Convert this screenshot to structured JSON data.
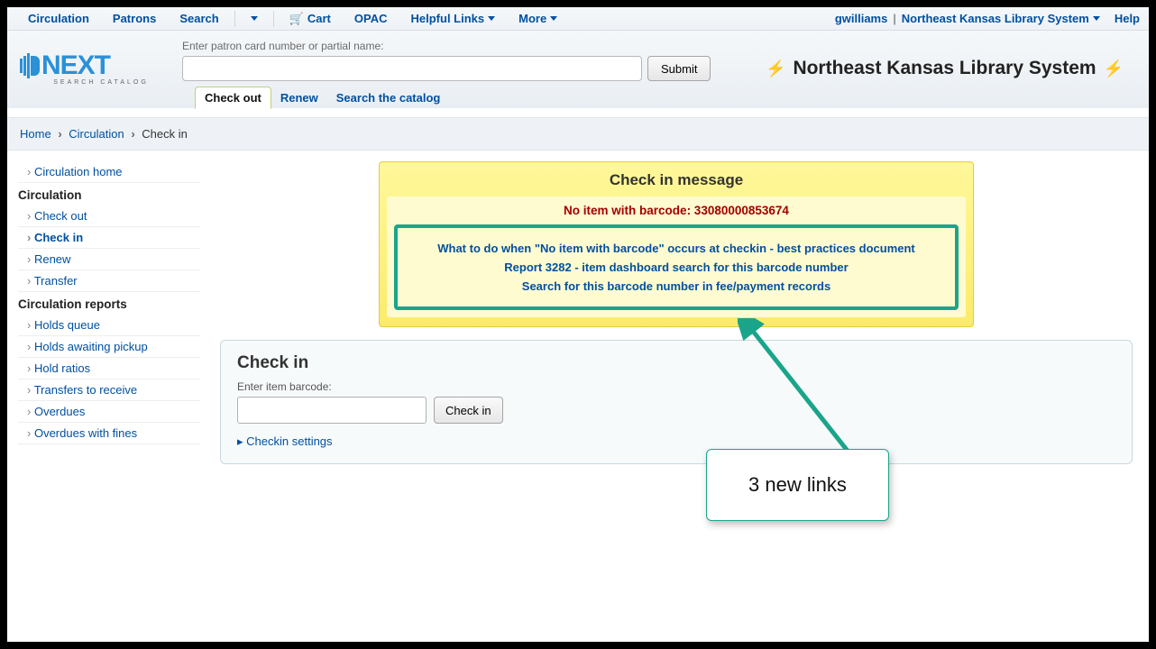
{
  "topnav": {
    "circulation": "Circulation",
    "patrons": "Patrons",
    "search": "Search",
    "cart": "Cart",
    "opac": "OPAC",
    "helpful": "Helpful Links",
    "more": "More",
    "user": "gwilliams",
    "system": "Northeast Kansas Library System",
    "help": "Help"
  },
  "logo": {
    "main": "NEXT",
    "sub": "SEARCH CATALOG"
  },
  "search": {
    "label": "Enter patron card number or partial name:",
    "submit": "Submit",
    "tabs": {
      "checkout": "Check out",
      "renew": "Renew",
      "catalog": "Search the catalog"
    }
  },
  "org_title": "Northeast Kansas Library System",
  "breadcrumb": {
    "home": "Home",
    "circ": "Circulation",
    "cur": "Check in"
  },
  "sidebar": {
    "circ_home": "Circulation home",
    "head1": "Circulation",
    "checkout": "Check out",
    "checkin": "Check in",
    "renew": "Renew",
    "transfer": "Transfer",
    "head2": "Circulation reports",
    "holdsq": "Holds queue",
    "holdsawait": "Holds awaiting pickup",
    "holdratios": "Hold ratios",
    "transfersrec": "Transfers to receive",
    "overdues": "Overdues",
    "overduesfines": "Overdues with fines"
  },
  "msg": {
    "title": "Check in message",
    "noitem": "No item with barcode: 33080000853674",
    "link1": "What to do when \"No item with barcode\" occurs at checkin - best practices document",
    "link2": "Report 3282 - item dashboard search for this barcode number",
    "link3": "Search for this barcode number in fee/payment records"
  },
  "checkin": {
    "title": "Check in",
    "label": "Enter item barcode:",
    "button": "Check in",
    "settings": "Checkin settings"
  },
  "annotation": {
    "text": "3 new links"
  }
}
